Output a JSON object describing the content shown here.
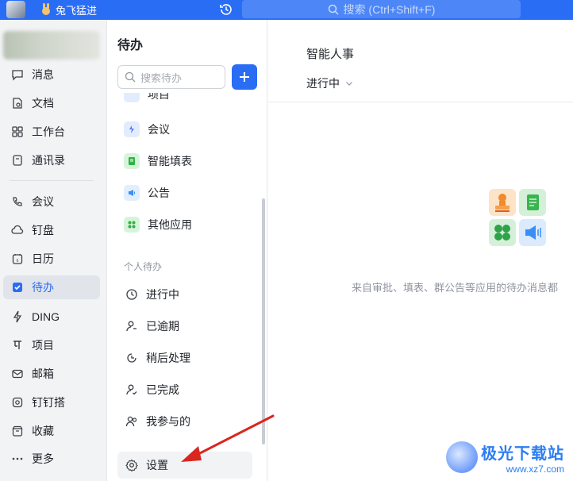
{
  "topbar": {
    "user_name": "兔飞猛进",
    "search_placeholder": "搜索 (Ctrl+Shift+F)"
  },
  "nav": {
    "items": [
      {
        "label": "消息",
        "icon": "chat-icon"
      },
      {
        "label": "文档",
        "icon": "document-icon"
      },
      {
        "label": "工作台",
        "icon": "grid-icon"
      },
      {
        "label": "通讯录",
        "icon": "contacts-icon"
      },
      {
        "label": "会议",
        "icon": "phone-icon"
      },
      {
        "label": "钉盘",
        "icon": "cloud-icon"
      },
      {
        "label": "日历",
        "icon": "calendar-icon"
      },
      {
        "label": "待办",
        "icon": "checkbox-icon",
        "active": true
      },
      {
        "label": "DING",
        "icon": "lightning-icon"
      },
      {
        "label": "项目",
        "icon": "project-icon"
      },
      {
        "label": "邮箱",
        "icon": "mail-icon"
      },
      {
        "label": "钉钉搭",
        "icon": "build-icon"
      },
      {
        "label": "收藏",
        "icon": "archive-icon"
      },
      {
        "label": "更多",
        "icon": "more-icon"
      }
    ]
  },
  "todo": {
    "title": "待办",
    "search_placeholder": "搜索待办",
    "partial_item": "项目",
    "apps": [
      {
        "label": "会议",
        "icon": "meeting-icon",
        "color": "#4a7bf7"
      },
      {
        "label": "智能填表",
        "icon": "form-icon",
        "color": "#2fb344"
      },
      {
        "label": "公告",
        "icon": "announcement-icon",
        "color": "#3a8ef6"
      },
      {
        "label": "其他应用",
        "icon": "apps-icon",
        "color": "#2fb344"
      }
    ],
    "personal_section": "个人待办",
    "personal": [
      {
        "label": "进行中",
        "icon": "clock-icon"
      },
      {
        "label": "已逾期",
        "icon": "overdue-icon"
      },
      {
        "label": "稍后处理",
        "icon": "later-icon"
      },
      {
        "label": "已完成",
        "icon": "done-icon"
      },
      {
        "label": "我参与的",
        "icon": "participants-icon"
      }
    ],
    "settings": "设置"
  },
  "main": {
    "title": "智能人事",
    "status": "进行中",
    "empty_text": "来自审批、填表、群公告等应用的待办消息都"
  },
  "watermark": {
    "cn": "极光下载站",
    "en": "www.xz7.com"
  },
  "colors": {
    "accent": "#2a6df5",
    "arrow": "#d9271f"
  }
}
